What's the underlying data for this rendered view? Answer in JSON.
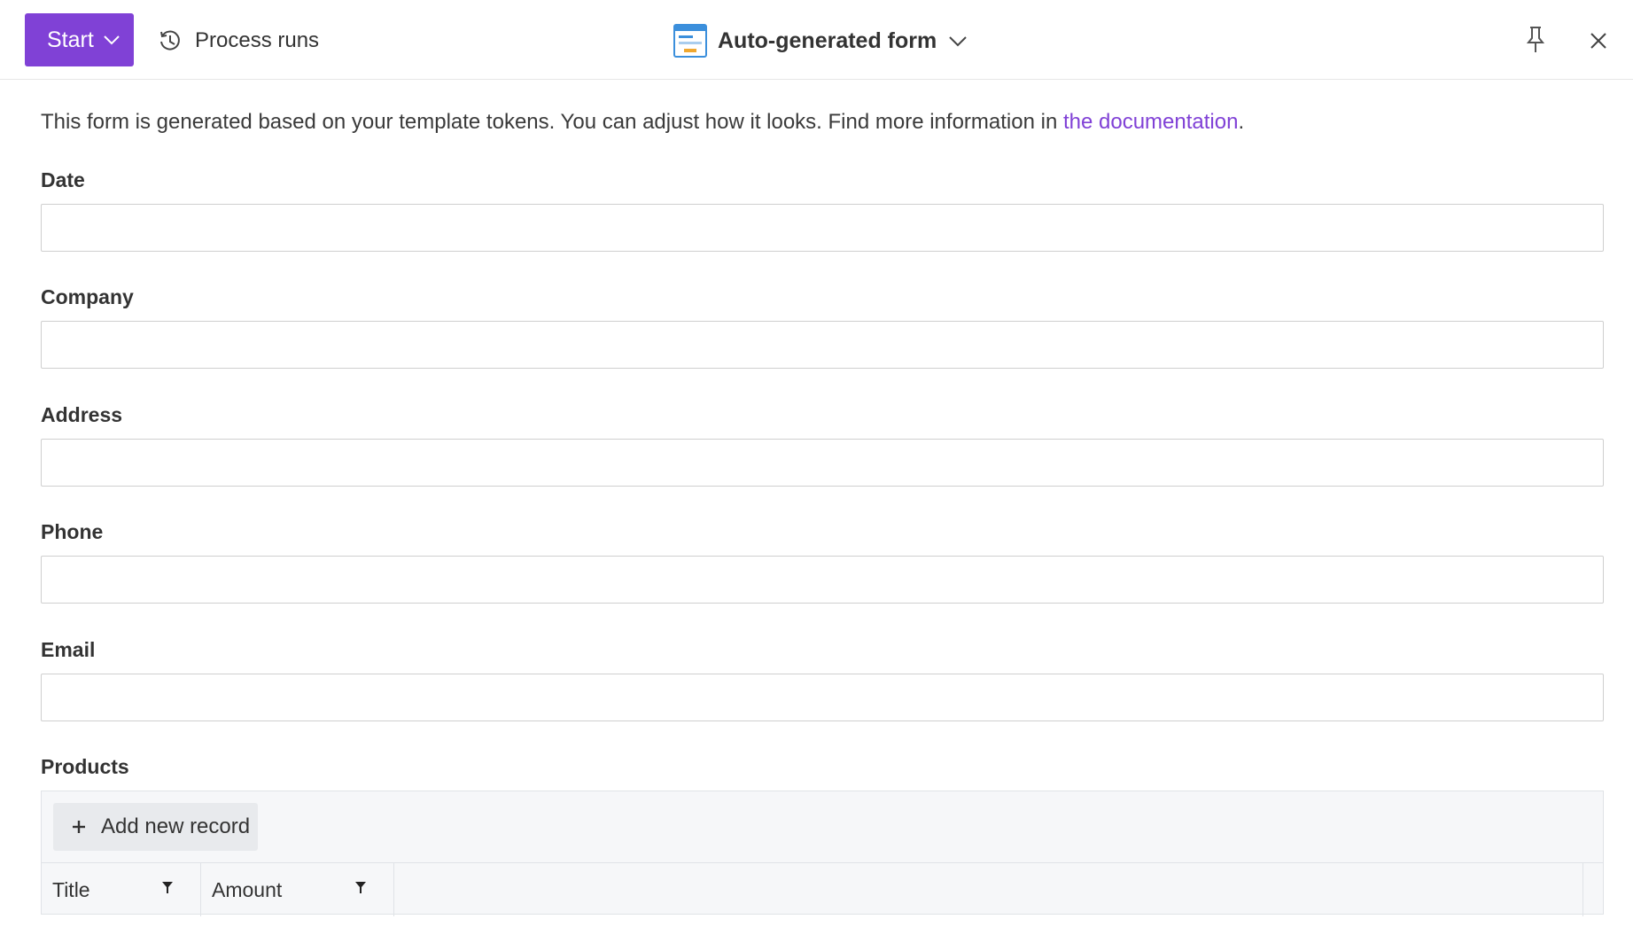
{
  "header": {
    "start_label": "Start",
    "process_runs_label": "Process runs",
    "form_title": "Auto-generated form"
  },
  "intro": {
    "text": "This form is generated based on your template tokens. You can adjust how it looks. Find more information in ",
    "link_text": "the documentation",
    "suffix": "."
  },
  "fields": [
    {
      "label": "Date",
      "value": ""
    },
    {
      "label": "Company",
      "value": ""
    },
    {
      "label": "Address",
      "value": ""
    },
    {
      "label": "Phone",
      "value": ""
    },
    {
      "label": "Email",
      "value": ""
    }
  ],
  "products": {
    "label": "Products",
    "add_label": "Add new record",
    "columns": [
      "Title",
      "Amount"
    ]
  },
  "colors": {
    "accent": "#8041d6",
    "link": "#8041d6"
  },
  "icons": [
    "chevron-down-icon",
    "history-icon",
    "form-icon",
    "pin-icon",
    "close-icon",
    "plus-icon",
    "filter-icon"
  ]
}
